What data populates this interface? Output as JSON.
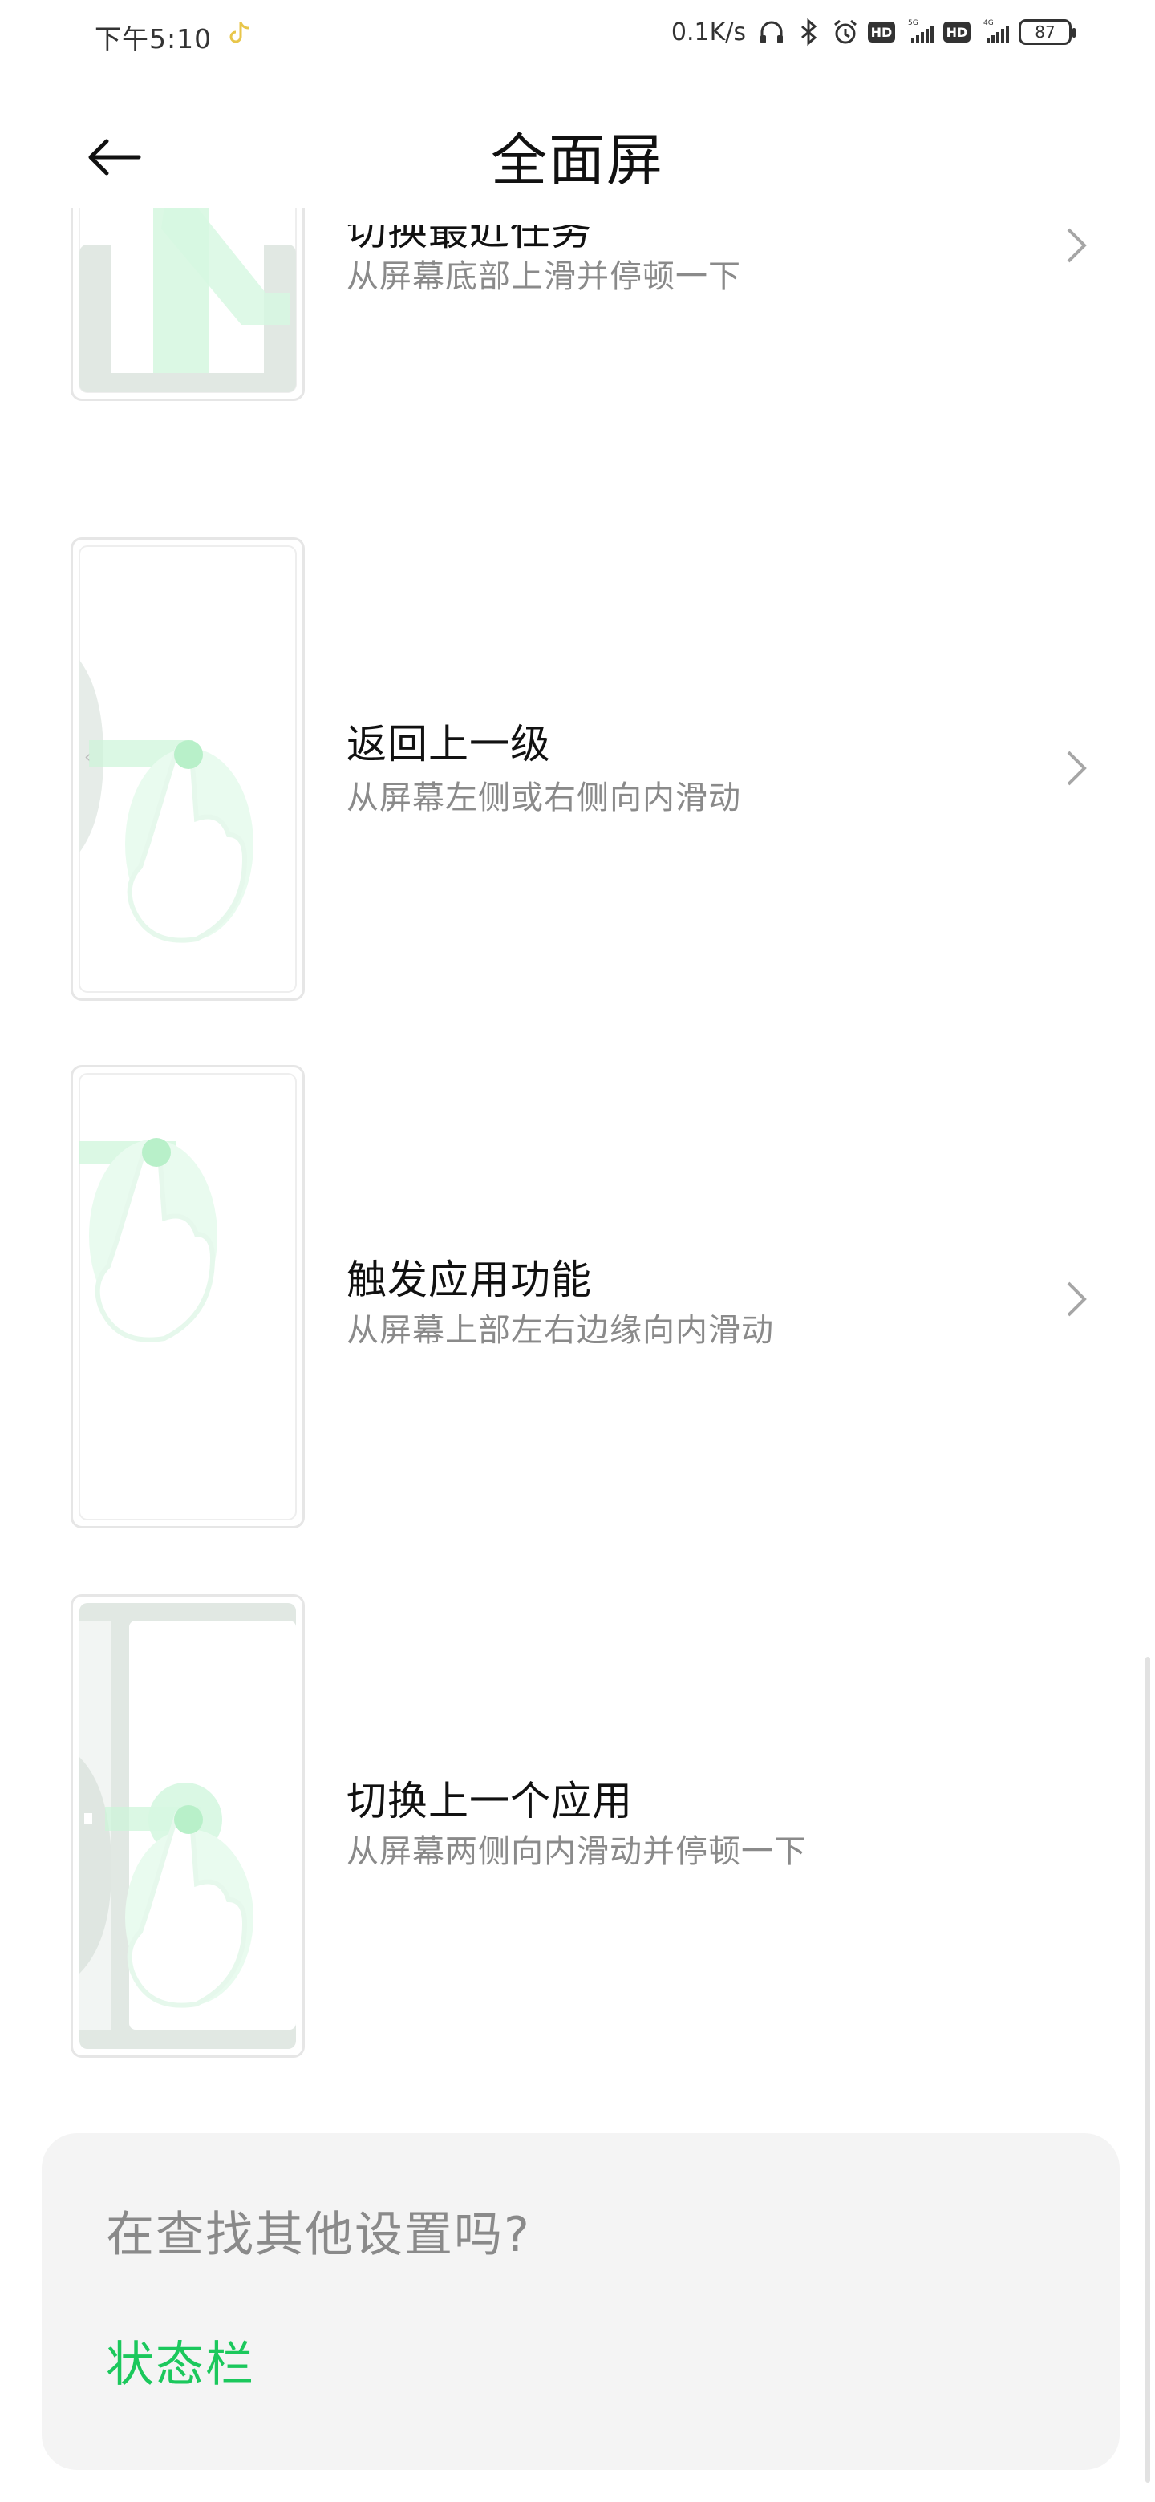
{
  "status_bar": {
    "time": "下午5:10",
    "network_speed": "0.1K/s",
    "signal1_label": "5G",
    "signal2_label": "4G",
    "hd_label": "HD",
    "battery": "87"
  },
  "header": {
    "title": "全面屏",
    "back_icon": "arrow-left-icon"
  },
  "gestures": [
    {
      "title": "切换最近任务",
      "subtitle": "从屏幕底部上滑并停顿一下"
    },
    {
      "title": "返回上一级",
      "subtitle": "从屏幕左侧或右侧向内滑动"
    },
    {
      "title": "触发应用功能",
      "subtitle": "从屏幕上部左右边缘向内滑动"
    },
    {
      "title": "切换上一个应用",
      "subtitle": "从屏幕两侧向内滑动并停顿一下"
    }
  ],
  "find_more": {
    "title": "在查找其他设置吗?",
    "link": "状态栏"
  },
  "colors": {
    "accent_green": "#1bc85c",
    "subtitle_gray": "#8a8a8a",
    "card_bg": "#f4f4f4"
  }
}
